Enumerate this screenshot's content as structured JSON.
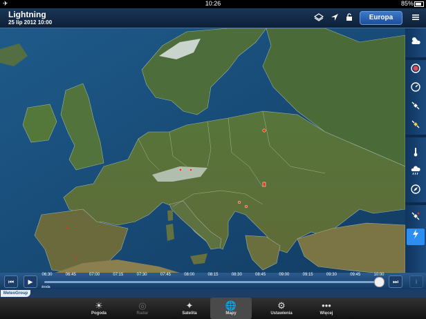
{
  "status_bar": {
    "time": "10:26",
    "battery": "85%",
    "airplane_icon": "airplane-icon"
  },
  "header": {
    "title": "Lightning",
    "subtitle": "25 lip 2012 10:00",
    "region_button": "Europa",
    "icons": [
      "layers-icon",
      "location-arrow-icon",
      "lock-icon",
      "menu-icon"
    ]
  },
  "sidebar": {
    "items": [
      {
        "name": "weather-overview",
        "icon": "sun-cloud-icon",
        "active": false
      },
      {
        "name": "color-wheel",
        "icon": "color-wheel-icon",
        "active": false
      },
      {
        "name": "circle-gauge",
        "icon": "gauge-icon",
        "active": false
      },
      {
        "name": "satellite",
        "icon": "satellite-icon",
        "active": false
      },
      {
        "name": "satellite-color",
        "icon": "satellite-color-icon",
        "active": false
      },
      {
        "name": "temperature",
        "icon": "thermometer-icon",
        "active": false
      },
      {
        "name": "precipitation",
        "icon": "rain-cloud-icon",
        "active": false
      },
      {
        "name": "wind",
        "icon": "compass-icon",
        "active": false
      },
      {
        "name": "satellite-radar",
        "icon": "satellite-dish-icon",
        "active": false
      },
      {
        "name": "lightning",
        "icon": "lightning-icon",
        "active": true
      }
    ]
  },
  "timeline": {
    "ticks": [
      "06:30",
      "06:45",
      "07:00",
      "07:15",
      "07:30",
      "07:45",
      "08:00",
      "08:15",
      "08:30",
      "08:45",
      "09:00",
      "09:15",
      "09:30",
      "09:45",
      "10:00"
    ],
    "day_label": "środa",
    "selected_fraction": 1.0,
    "buttons": {
      "rewind": "⏮",
      "play": "▶",
      "forward": "⏭",
      "info": "i"
    }
  },
  "brand": "MeteoGroup",
  "tabs": [
    {
      "label": "Pogoda",
      "icon": "sun-cloud-icon",
      "active": false,
      "dim": false
    },
    {
      "label": "Radar",
      "icon": "radar-icon",
      "active": false,
      "dim": true
    },
    {
      "label": "Satelita",
      "icon": "satellite-icon",
      "active": false,
      "dim": false
    },
    {
      "label": "Mapy",
      "icon": "globe-icon",
      "active": true,
      "dim": false
    },
    {
      "label": "Ustawienia",
      "icon": "gear-icon",
      "active": false,
      "dim": false
    },
    {
      "label": "Więcej",
      "icon": "more-dots-icon",
      "active": false,
      "dim": false
    }
  ],
  "colors": {
    "accent": "#2c8ef0",
    "lightning_marker": "#e23a12",
    "sea": "#16446c",
    "land": "#4f6a34"
  }
}
